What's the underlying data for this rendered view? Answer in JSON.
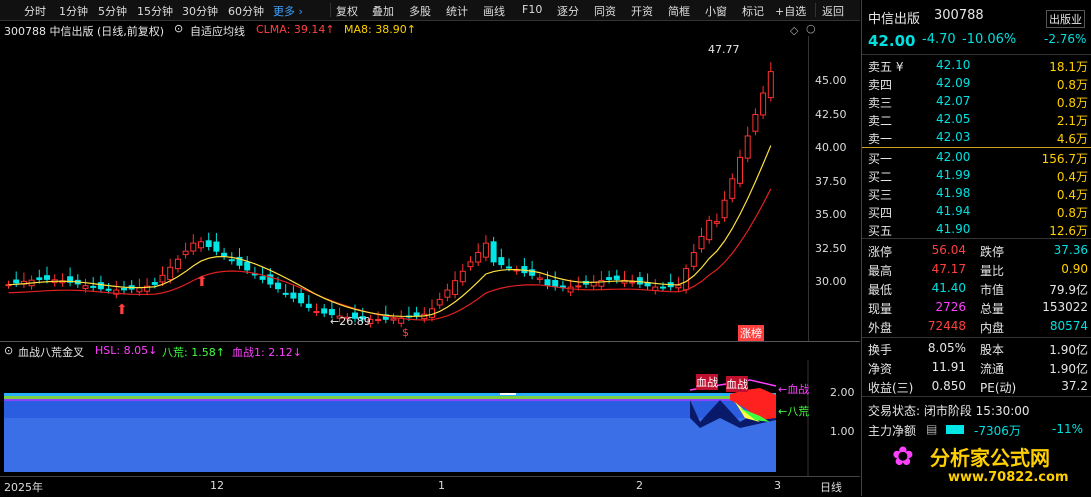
{
  "toolbar": {
    "periods": [
      "分时",
      "1分钟",
      "5分钟",
      "15分钟",
      "30分钟",
      "60分钟"
    ],
    "more": "更多 ›",
    "actions": [
      "复权",
      "叠加",
      "多股",
      "统计",
      "画线",
      "F10",
      "逐分",
      "同资",
      "开资",
      "简框",
      "小窗",
      "标记",
      "+自选",
      "返回"
    ]
  },
  "chart_header": {
    "stock": "300788  中信出版 (日线,前复权)",
    "indicator": "自适应均线",
    "clma": "CLMA: 39.14↑",
    "ma8": "MA8: 38.90↑"
  },
  "price_axis": [
    "45.00",
    "42.50",
    "40.00",
    "37.50",
    "35.00",
    "32.50",
    "30.00"
  ],
  "annotations": {
    "high": "47.77",
    "low": "←26.89",
    "limit_up": "涨榜",
    "s_mark": "$"
  },
  "sub_header": {
    "name": "血战八荒金叉",
    "hsl": "HSL: 8.05↓",
    "bahuang": "八荒: 1.58↑",
    "xuezhan": "血战1: 2.12↓"
  },
  "sub_axis": [
    "2.00",
    "1.00"
  ],
  "sub_labels": {
    "xuezhan_a": "血战",
    "xuezhan_b": "血战",
    "xuezhan_right": "←血战",
    "bahuang_right": "←八荒"
  },
  "time_axis": [
    "2025年",
    "12",
    "1",
    "2",
    "3"
  ],
  "time_axis_right": "日线",
  "quote": {
    "name": "中信出版",
    "code": "300788",
    "tag": "出版业",
    "price": "42.00",
    "change": "-4.70",
    "pct": "-10.06%",
    "sector_pct": "-2.76%"
  },
  "asks": [
    {
      "label": "卖五 ¥",
      "price": "42.10",
      "vol": "18.1万"
    },
    {
      "label": "卖四",
      "price": "42.09",
      "vol": "0.8万"
    },
    {
      "label": "卖三",
      "price": "42.07",
      "vol": "0.8万"
    },
    {
      "label": "卖二",
      "price": "42.05",
      "vol": "2.1万"
    },
    {
      "label": "卖一",
      "price": "42.03",
      "vol": "4.6万"
    }
  ],
  "bids": [
    {
      "label": "买一",
      "price": "42.00",
      "vol": "156.7万"
    },
    {
      "label": "买二",
      "price": "41.99",
      "vol": "0.4万"
    },
    {
      "label": "买三",
      "price": "41.98",
      "vol": "0.4万"
    },
    {
      "label": "买四",
      "price": "41.94",
      "vol": "0.8万"
    },
    {
      "label": "买五",
      "price": "41.90",
      "vol": "12.6万"
    }
  ],
  "stats": [
    {
      "l1": "涨停",
      "v1": "56.04",
      "l2": "跌停",
      "v2": "37.36"
    },
    {
      "l1": "最高",
      "v1": "47.17",
      "l2": "量比",
      "v2": "0.90"
    },
    {
      "l1": "最低",
      "v1": "41.40",
      "l2": "市值",
      "v2": "79.9亿"
    },
    {
      "l1": "现量",
      "v1": "2726",
      "l2": "总量",
      "v2": "153022"
    },
    {
      "l1": "外盘",
      "v1": "72448",
      "l2": "内盘",
      "v2": "80574"
    }
  ],
  "stats2": [
    {
      "l1": "换手",
      "v1": "8.05%",
      "l2": "股本",
      "v2": "1.90亿"
    },
    {
      "l1": "净资",
      "v1": "11.91",
      "l2": "流通",
      "v2": "1.90亿"
    },
    {
      "l1": "收益(三)",
      "v1": "0.850",
      "l2": "PE(动)",
      "v2": "37.2"
    }
  ],
  "trade_status": "交易状态: 闭市阶段 15:30:00",
  "main_flow": {
    "label": "主力净额",
    "value": "-7306万",
    "pct": "-11%"
  },
  "logo": {
    "text": "分析家公式网",
    "url": "www.70822.com"
  },
  "colors": {
    "up": "#ff3030",
    "down": "#00e5e5",
    "ma_yellow": "#ffe040",
    "ma_red": "#e02020",
    "blue_area": "#3b6fe8"
  }
}
